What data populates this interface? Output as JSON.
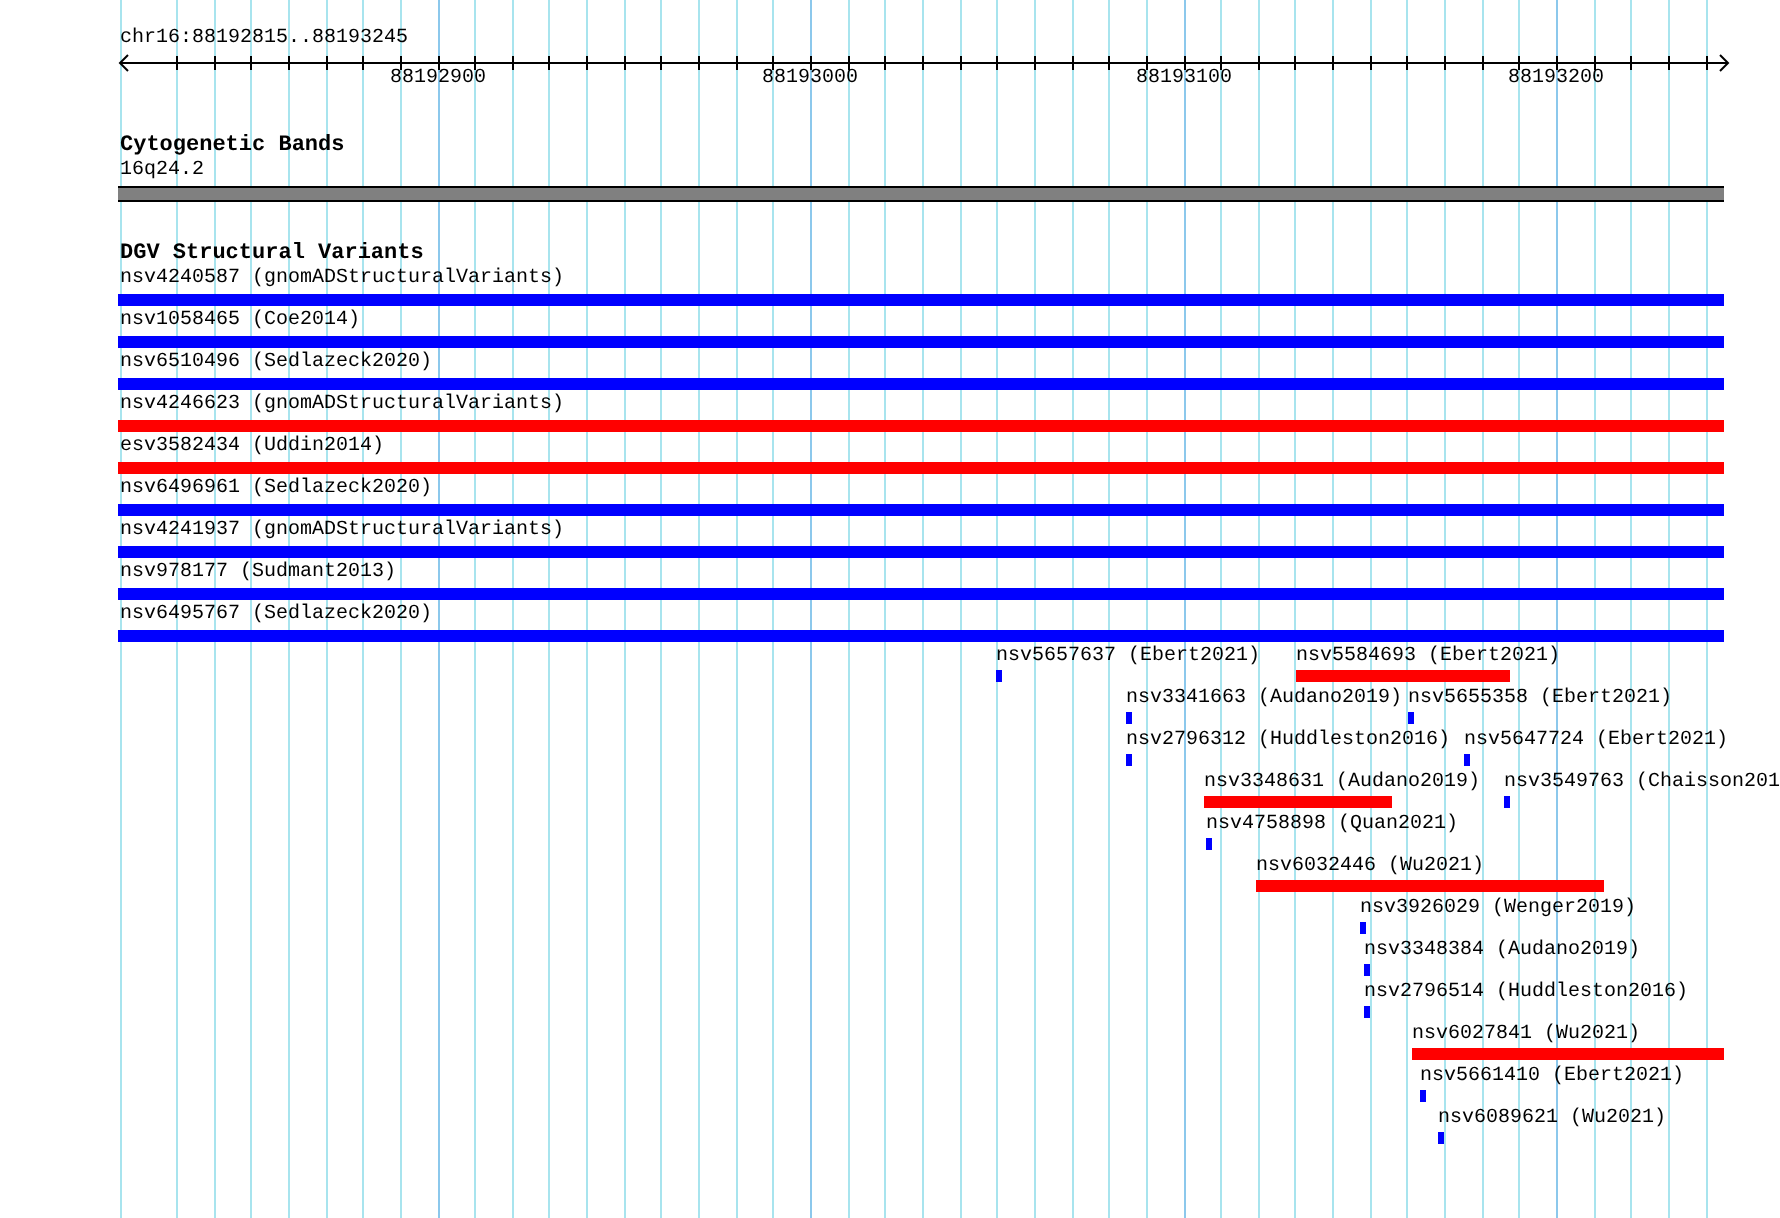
{
  "ruler": {
    "region": "chr16:88192815..88193245",
    "ticks": [
      "88192900",
      "88193000",
      "88193100",
      "88193200"
    ]
  },
  "cytogenetic_bands": {
    "title": "Cytogenetic Bands",
    "band": "16q24.2"
  },
  "dgv": {
    "title": "DGV Structural Variants",
    "variants": [
      {
        "label": "nsv4240587 (gnomADStructuralVariants)",
        "color": "#0000ff"
      },
      {
        "label": "nsv1058465 (Coe2014)",
        "color": "#0000ff"
      },
      {
        "label": "nsv6510496 (Sedlazeck2020)",
        "color": "#0000ff"
      },
      {
        "label": "nsv4246623 (gnomADStructuralVariants)",
        "color": "#ff0000"
      },
      {
        "label": "esv3582434 (Uddin2014)",
        "color": "#ff0000"
      },
      {
        "label": "nsv6496961 (Sedlazeck2020)",
        "color": "#0000ff"
      },
      {
        "label": "nsv4241937 (gnomADStructuralVariants)",
        "color": "#0000ff"
      },
      {
        "label": "nsv978177 (Sudmant2013)",
        "color": "#0000ff"
      },
      {
        "label": "nsv6495767 (Sedlazeck2020)",
        "color": "#0000ff"
      },
      {
        "label": "nsv5657637 (Ebert2021)",
        "color": "#0000ff"
      },
      {
        "label": "nsv5584693 (Ebert2021)",
        "color": "#ff0000"
      },
      {
        "label": "nsv3341663 (Audano2019)",
        "color": "#0000ff"
      },
      {
        "label": "nsv5655358 (Ebert2021)",
        "color": "#0000ff"
      },
      {
        "label": "nsv2796312 (Huddleston2016)",
        "color": "#0000ff"
      },
      {
        "label": "nsv5647724 (Ebert2021)",
        "color": "#0000ff"
      },
      {
        "label": "nsv3348631 (Audano2019)",
        "color": "#ff0000"
      },
      {
        "label": "nsv3549763 (Chaisson201",
        "color": "#0000ff"
      },
      {
        "label": "nsv4758898 (Quan2021)",
        "color": "#0000ff"
      },
      {
        "label": "nsv6032446 (Wu2021)",
        "color": "#ff0000"
      },
      {
        "label": "nsv3926029 (Wenger2019)",
        "color": "#0000ff"
      },
      {
        "label": "nsv3348384 (Audano2019)",
        "color": "#0000ff"
      },
      {
        "label": "nsv2796514 (Huddleston2016)",
        "color": "#0000ff"
      },
      {
        "label": "nsv6027841 (Wu2021)",
        "color": "#ff0000"
      },
      {
        "label": "nsv5661410 (Ebert2021)",
        "color": "#0000ff"
      },
      {
        "label": "nsv6089621 (Wu2021)",
        "color": "#0000ff"
      }
    ]
  }
}
